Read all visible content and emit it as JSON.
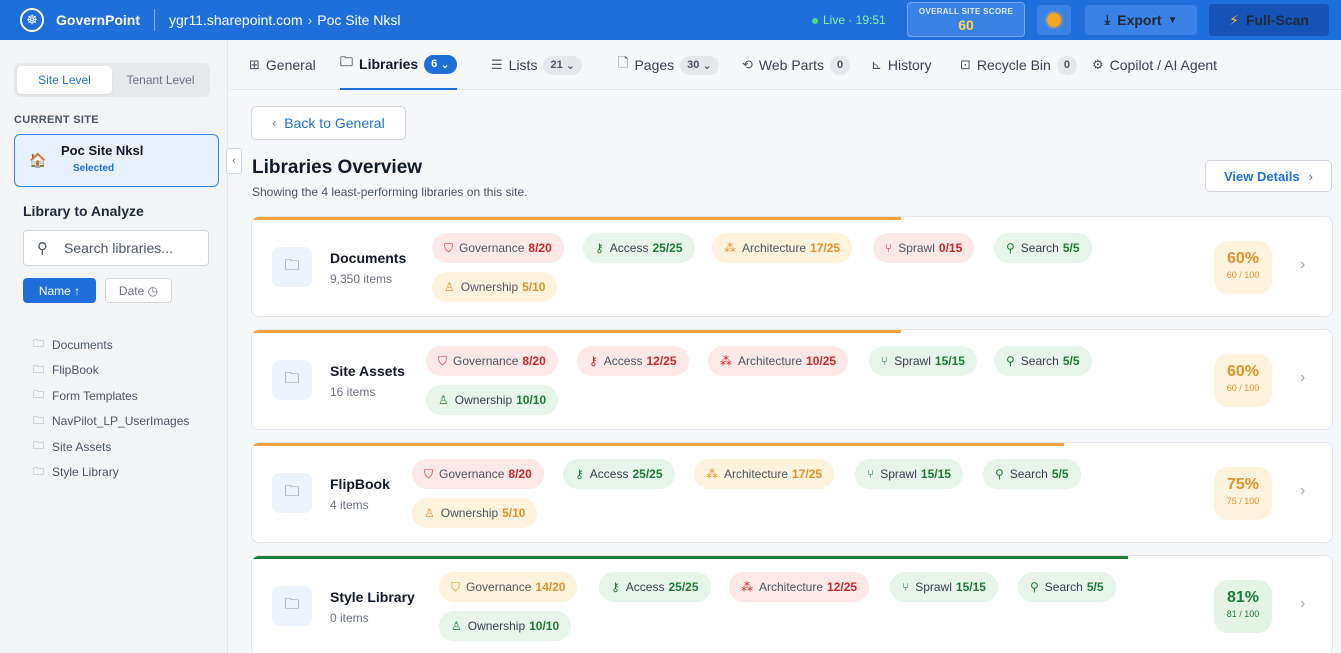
{
  "app": {
    "name": "GovernPoint",
    "breadcrumb": [
      "ygr11.sharepoint.com",
      "Poc Site Nksl"
    ],
    "breadcrumb_sep": "›",
    "live_label": "Live · 19:51",
    "overall_label": "OVERALL SITE SCORE",
    "overall_value": "60",
    "export_label": "Export",
    "fullscan_label": "Full-Scan"
  },
  "sidebar": {
    "level_tabs": [
      "Site Level",
      "Tenant Level"
    ],
    "current_site_title": "CURRENT SITE",
    "site_name": "Poc Site Nksl",
    "site_status": "Selected",
    "library_title": "Library to Analyze",
    "search_placeholder": "Search libraries...",
    "sort_name": "Name ↑",
    "sort_date": "Date",
    "libraries": [
      "Documents",
      "FlipBook",
      "Form Templates",
      "NavPilot_LP_UserImages",
      "Site Assets",
      "Style Library"
    ]
  },
  "tabs": [
    {
      "label": "General",
      "icon": "grid-icon",
      "count": ""
    },
    {
      "label": "Libraries",
      "icon": "folder-icon",
      "count": "6"
    },
    {
      "label": "Lists",
      "icon": "list-icon",
      "count": "21"
    },
    {
      "label": "Pages",
      "icon": "page-icon",
      "count": "30"
    },
    {
      "label": "Web Parts",
      "icon": "puzzle-icon",
      "count": "0"
    },
    {
      "label": "History",
      "icon": "chart-icon",
      "count": ""
    },
    {
      "label": "Recycle Bin",
      "icon": "bin-icon",
      "count": "0"
    },
    {
      "label": "Copilot / AI Agent",
      "icon": "bot-icon",
      "count": ""
    }
  ],
  "main": {
    "back_label": "Back to General",
    "title": "Libraries Overview",
    "subtitle": "Showing the 4 least-performing libraries on this site.",
    "view_details": "View Details"
  },
  "libraries": [
    {
      "name": "Documents",
      "items": "9,350 items",
      "score_pct": "60%",
      "score_of": "60 / 100",
      "score": 60,
      "chips": [
        {
          "label": "Governance",
          "value": "8/20"
        },
        {
          "label": "Access",
          "value": "25/25"
        },
        {
          "label": "Architecture",
          "value": "17/25"
        },
        {
          "label": "Sprawl",
          "value": "0/15"
        },
        {
          "label": "Search",
          "value": "5/5"
        },
        {
          "label": "Ownership",
          "value": "5/10"
        }
      ]
    },
    {
      "name": "Site Assets",
      "items": "16 items",
      "score_pct": "60%",
      "score_of": "60 / 100",
      "score": 60,
      "chips": [
        {
          "label": "Governance",
          "value": "8/20"
        },
        {
          "label": "Access",
          "value": "12/25"
        },
        {
          "label": "Architecture",
          "value": "10/25"
        },
        {
          "label": "Sprawl",
          "value": "15/15"
        },
        {
          "label": "Search",
          "value": "5/5"
        },
        {
          "label": "Ownership",
          "value": "10/10"
        }
      ]
    },
    {
      "name": "FlipBook",
      "items": "4 items",
      "score_pct": "75%",
      "score_of": "75 / 100",
      "score": 75,
      "chips": [
        {
          "label": "Governance",
          "value": "8/20"
        },
        {
          "label": "Access",
          "value": "25/25"
        },
        {
          "label": "Architecture",
          "value": "17/25"
        },
        {
          "label": "Sprawl",
          "value": "15/15"
        },
        {
          "label": "Search",
          "value": "5/5"
        },
        {
          "label": "Ownership",
          "value": "5/10"
        }
      ]
    },
    {
      "name": "Style Library",
      "items": "0 items",
      "score_pct": "81%",
      "score_of": "81 / 100",
      "score": 81,
      "chips": [
        {
          "label": "Governance",
          "value": "14/20"
        },
        {
          "label": "Access",
          "value": "25/25"
        },
        {
          "label": "Architecture",
          "value": "12/25"
        },
        {
          "label": "Sprawl",
          "value": "15/15"
        },
        {
          "label": "Search",
          "value": "5/5"
        },
        {
          "label": "Ownership",
          "value": "10/10"
        }
      ]
    }
  ],
  "colors": {
    "brand": "#1e6fd9",
    "warning": "#e0922a",
    "success": "#1e7b34",
    "danger": "#c62828"
  }
}
